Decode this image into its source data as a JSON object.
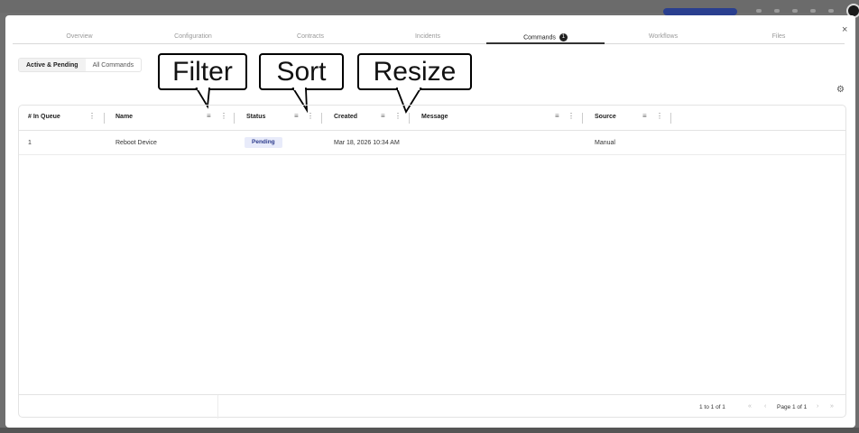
{
  "tabs": [
    {
      "label": "Overview"
    },
    {
      "label": "Configuration"
    },
    {
      "label": "Contracts"
    },
    {
      "label": "Incidents"
    },
    {
      "label": "Commands",
      "badge": "1",
      "active": true
    },
    {
      "label": "Workflows"
    },
    {
      "label": "Files"
    }
  ],
  "close_label": "×",
  "segments": {
    "active": "Active & Pending",
    "all": "All Commands"
  },
  "settings_icon": "⚙",
  "columns": [
    "# In Queue",
    "Name",
    "Status",
    "Created",
    "Message",
    "Source"
  ],
  "column_icons": {
    "filter": "≡",
    "menu": "⋮"
  },
  "rows": [
    {
      "queue": "1",
      "name": "Reboot Device",
      "status": "Pending",
      "created": "Mar 18, 2026 10:34 AM",
      "message": "",
      "source": "Manual"
    }
  ],
  "pagination": {
    "range": "1 to 1 of 1",
    "page": "Page 1 of 1",
    "first": "«",
    "prev": "‹",
    "next": "›",
    "last": "»"
  },
  "callouts": {
    "filter": "Filter",
    "sort": "Sort",
    "resize": "Resize"
  },
  "colors": {
    "accent": "#2a3f8f",
    "pending_bg": "#e8ebfa",
    "pending_text": "#2b3a8c"
  }
}
